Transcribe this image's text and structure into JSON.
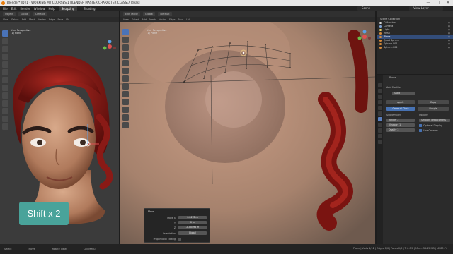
{
  "window": {
    "title": "Blender* [D:\\1 - WORKING MY COURSES\\1 BLENDER MASTER CHARACTER CLASS\\7 Ideas]",
    "min": "—",
    "max": "□",
    "close": "✕"
  },
  "menu": {
    "items": [
      "File",
      "Edit",
      "Render",
      "Window",
      "Help"
    ],
    "workspaces": [
      "Sculpting",
      "Shading"
    ],
    "scene": "Scene",
    "view_layer": "View Layer"
  },
  "left_editor": {
    "header": [
      "Object",
      "Global",
      "Default"
    ],
    "sub_header": [
      "View",
      "Select",
      "Add",
      "Mesh",
      "Vertex",
      "Edge",
      "Face",
      "UV"
    ],
    "view_label": "User Perspective",
    "object_label": "(1) Plane"
  },
  "right_editor": {
    "header": [
      "Edit Mode",
      "Global",
      "Default"
    ],
    "sub_header": [
      "View",
      "Select",
      "Add",
      "Mesh",
      "Vertex",
      "Edge",
      "Face",
      "UV"
    ],
    "view_label": "User Perspective",
    "object_label": "(1) Plane"
  },
  "shift_label": "Shift x 2",
  "operator_panel": {
    "title": "Move",
    "fields": [
      {
        "label": "Move X",
        "value": "0.0478 m"
      },
      {
        "label": "Y",
        "value": "0 m"
      },
      {
        "label": "Z",
        "value": "-0.00596 m"
      },
      {
        "label": "Orientation",
        "value": "Global"
      },
      {
        "label": "Proportional Editing",
        "value": ""
      }
    ]
  },
  "outliner": {
    "title": "Scene Collection",
    "rows": [
      {
        "label": "Collection",
        "selected": false
      },
      {
        "label": "Camera",
        "selected": false
      },
      {
        "label": "Light",
        "selected": false
      },
      {
        "label": "Mesh",
        "selected": false
      },
      {
        "label": "Plane",
        "selected": true
      },
      {
        "label": "Quad Sphere",
        "selected": false
      },
      {
        "label": "Sphere.001",
        "selected": false
      },
      {
        "label": "Sphere.002",
        "selected": false
      }
    ]
  },
  "properties": {
    "object_name": "Plane",
    "modifier_header": "Add Modifier",
    "modifier_name": "Subd",
    "btn_apply": "Apply",
    "btn_copy": "Copy",
    "tab_catmull": "Catmull-Clark",
    "tab_simple": "Simple",
    "subdivisions_label": "Subdivisions",
    "options_label": "Options",
    "fields": [
      {
        "label": "Render",
        "value": "2"
      },
      {
        "label": "Viewport",
        "value": "1"
      },
      {
        "label": "Quality",
        "value": "3"
      }
    ],
    "options": [
      {
        "label": "Smooth, keep corners"
      },
      {
        "label": "Optimal Display"
      },
      {
        "label": "Use Creases"
      }
    ]
  },
  "statusbar": {
    "items": [
      "Select",
      "Move",
      "Rotate View",
      "Call Menu"
    ],
    "right": "Plane | Verts 1/12 | Edges 0/0 | Faces 0/0 | Tris 0/0 | Mem: 384.5 MB | v2.80.74"
  }
}
